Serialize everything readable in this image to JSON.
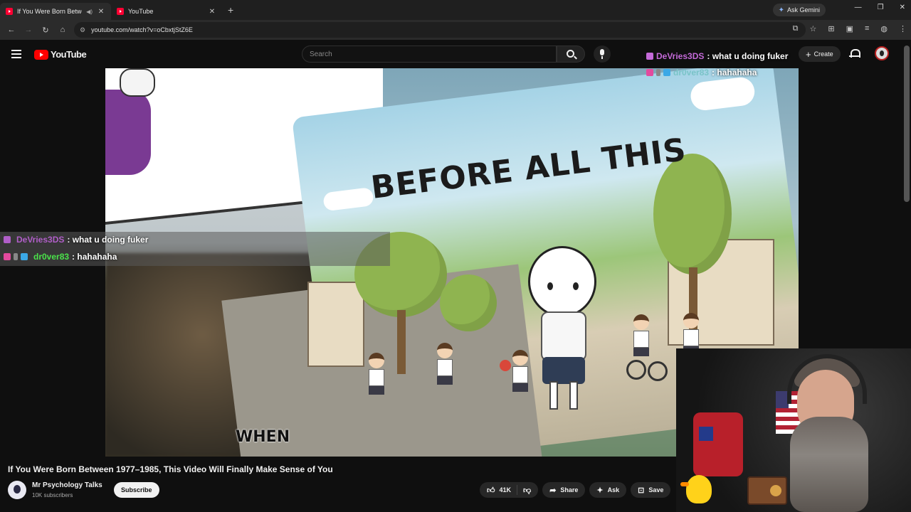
{
  "browser": {
    "tabs": [
      {
        "title": "If You Were Born Between",
        "active": true
      },
      {
        "title": "YouTube",
        "active": false
      }
    ],
    "ask_gemini": "Ask Gemini",
    "url": "youtube.com/watch?v=oCbxtjStZ6E"
  },
  "youtube": {
    "logo_text": "YouTube",
    "search_placeholder": "Search",
    "create_label": "Create"
  },
  "video": {
    "headline": "BEFORE ALL THIS",
    "subtitle": "WHEN"
  },
  "chat": [
    {
      "user": "DeVries3DS",
      "message": ": what u doing fuker",
      "user_color": "#b05ec8"
    },
    {
      "user": "dr0ver83",
      "message": ": hahahaha",
      "user_color": "#4ae24a"
    }
  ],
  "chat_top": [
    {
      "user": "DeVries3DS",
      "message": ": what u doing fuker",
      "user_color": "#c46ad8"
    },
    {
      "user": "dr0ver83",
      "message": ": hahahaha",
      "user_color": "#7ac4c8"
    }
  ],
  "info": {
    "title": "If You Were Born Between 1977–1985, This Video Will Finally Make Sense of You",
    "channel": "Mr Psychology Talks",
    "subscribers": "10K subscribers",
    "subscribe_label": "Subscribe",
    "likes": "41K",
    "share_label": "Share",
    "ask_label": "Ask",
    "save_label": "Save"
  },
  "colors": {
    "bg": "#0f0f0f",
    "brand_red": "#ff0000"
  }
}
